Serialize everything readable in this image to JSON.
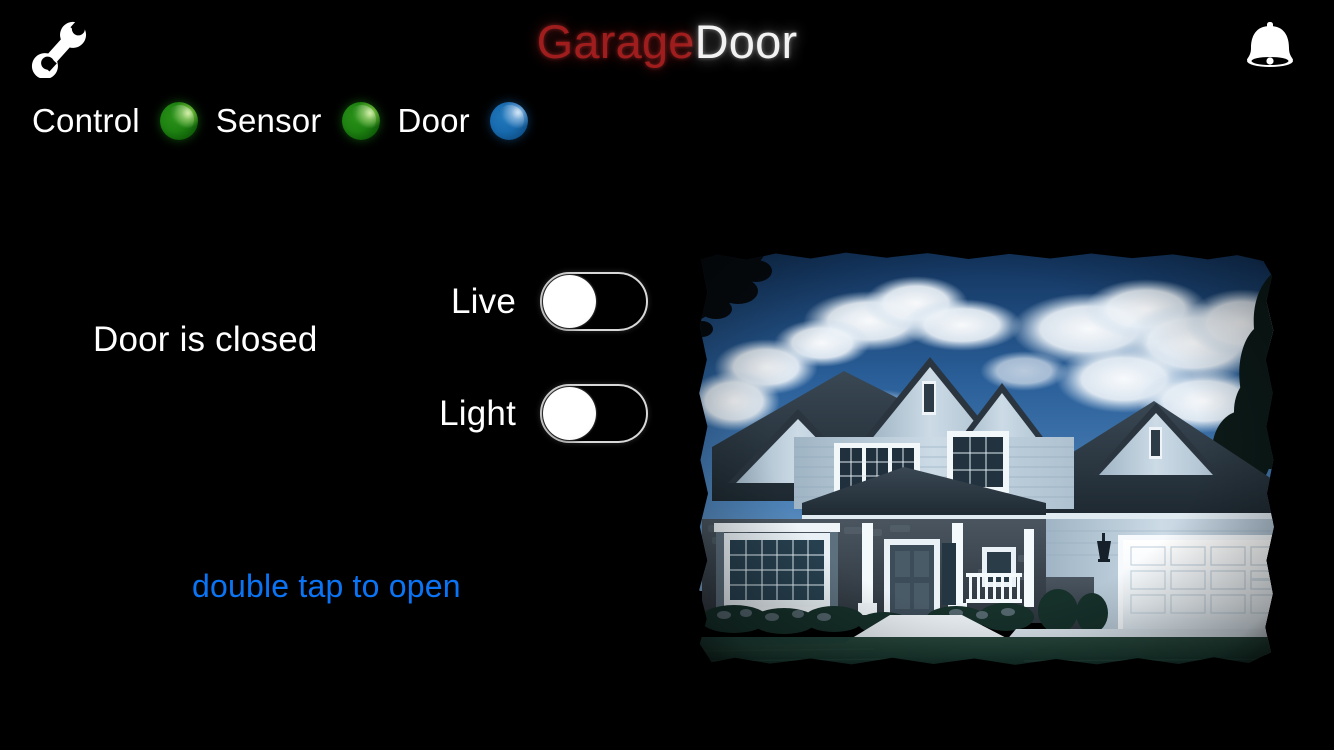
{
  "app": {
    "title_part1": "Garage",
    "title_part2": "Door",
    "title_color_1": "#a01d1d",
    "title_color_2": "#f2f2f2",
    "background": "#000000"
  },
  "topbar": {
    "settings_icon": "wrench-icon",
    "notifications_icon": "bell-icon"
  },
  "status_row": {
    "items": [
      {
        "label": "Control",
        "led_state": "green",
        "led_color": "#1e8211"
      },
      {
        "label": "Sensor",
        "led_state": "green",
        "led_color": "#1e8211"
      },
      {
        "label": "Door",
        "led_state": "blue",
        "led_color": "#176aad"
      }
    ]
  },
  "main": {
    "door_status": "Door is closed",
    "tap_hint": "double tap to open",
    "tap_hint_color": "#0a74f5",
    "toggles": [
      {
        "label": "Live",
        "state": "off"
      },
      {
        "label": "Light",
        "state": "off"
      }
    ]
  },
  "camera": {
    "alt": "front view of a two-story house with a closed white two-car garage door",
    "sky_color": "#2b5d99",
    "lawn_color": "#1b3a31",
    "siding_color": "#c9d8e4",
    "roof_color": "#2b3742",
    "garage_door_color": "#f4f8fb"
  }
}
